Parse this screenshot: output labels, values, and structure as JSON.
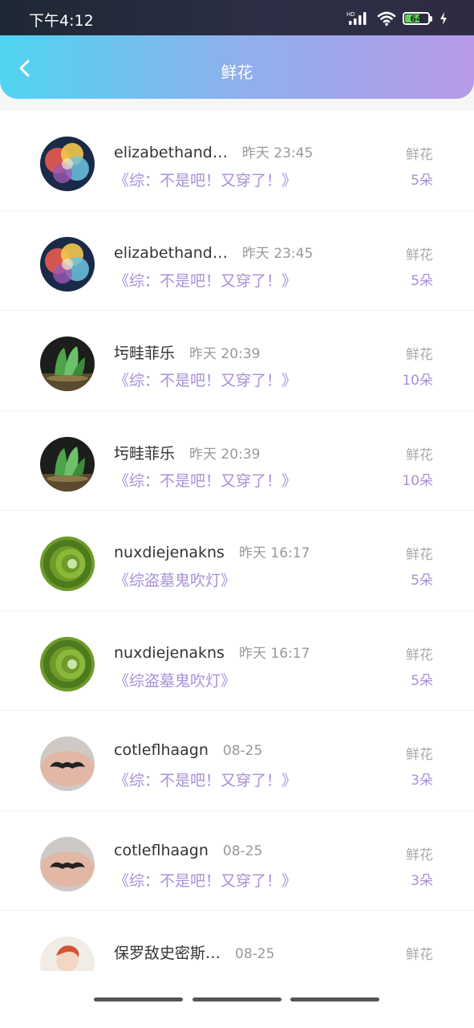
{
  "status_bar": {
    "time": "下午4:12",
    "icons": [
      "hd-icon",
      "signal-icon",
      "wifi-icon",
      "battery-icon",
      "charging-icon"
    ],
    "battery_level": "64",
    "hd_label": "HD"
  },
  "header": {
    "title": "鲜花",
    "back_icon": "chevron-left-icon",
    "gradient": [
      "#4fd4f0",
      "#b79ae9"
    ]
  },
  "records": [
    {
      "name": "elizabethand…",
      "time": "昨天 23:45",
      "book": "《综：不是吧！又穿了！》",
      "kind": "鲜花",
      "count": "5朵",
      "avatar": "balloons"
    },
    {
      "name": "elizabethand…",
      "time": "昨天 23:45",
      "book": "《综：不是吧！又穿了！》",
      "kind": "鲜花",
      "count": "5朵",
      "avatar": "balloons"
    },
    {
      "name": "圬畦菲乐",
      "time": "昨天 20:39",
      "book": "《综：不是吧！又穿了！》",
      "kind": "鲜花",
      "count": "10朵",
      "avatar": "jade"
    },
    {
      "name": "圬畦菲乐",
      "time": "昨天 20:39",
      "book": "《综：不是吧！又穿了！》",
      "kind": "鲜花",
      "count": "10朵",
      "avatar": "jade"
    },
    {
      "name": "nuxdiejenakns",
      "time": "昨天 16:17",
      "book": "《综盗墓鬼吹灯》",
      "kind": "鲜花",
      "count": "5朵",
      "avatar": "grass"
    },
    {
      "name": "nuxdiejenakns",
      "time": "昨天 16:17",
      "book": "《综盗墓鬼吹灯》",
      "kind": "鲜花",
      "count": "5朵",
      "avatar": "grass"
    },
    {
      "name": "cotleflhaagn",
      "time": "08-25",
      "book": "《综：不是吧！又穿了！》",
      "kind": "鲜花",
      "count": "3朵",
      "avatar": "mustache"
    },
    {
      "name": "cotleflhaagn",
      "time": "08-25",
      "book": "《综：不是吧！又穿了！》",
      "kind": "鲜花",
      "count": "3朵",
      "avatar": "mustache"
    },
    {
      "name": "保罗敌史密斯…",
      "time": "08-25",
      "book": "",
      "kind": "鲜花",
      "count": "",
      "avatar": "person"
    }
  ],
  "accent_color": "#a98fd8"
}
